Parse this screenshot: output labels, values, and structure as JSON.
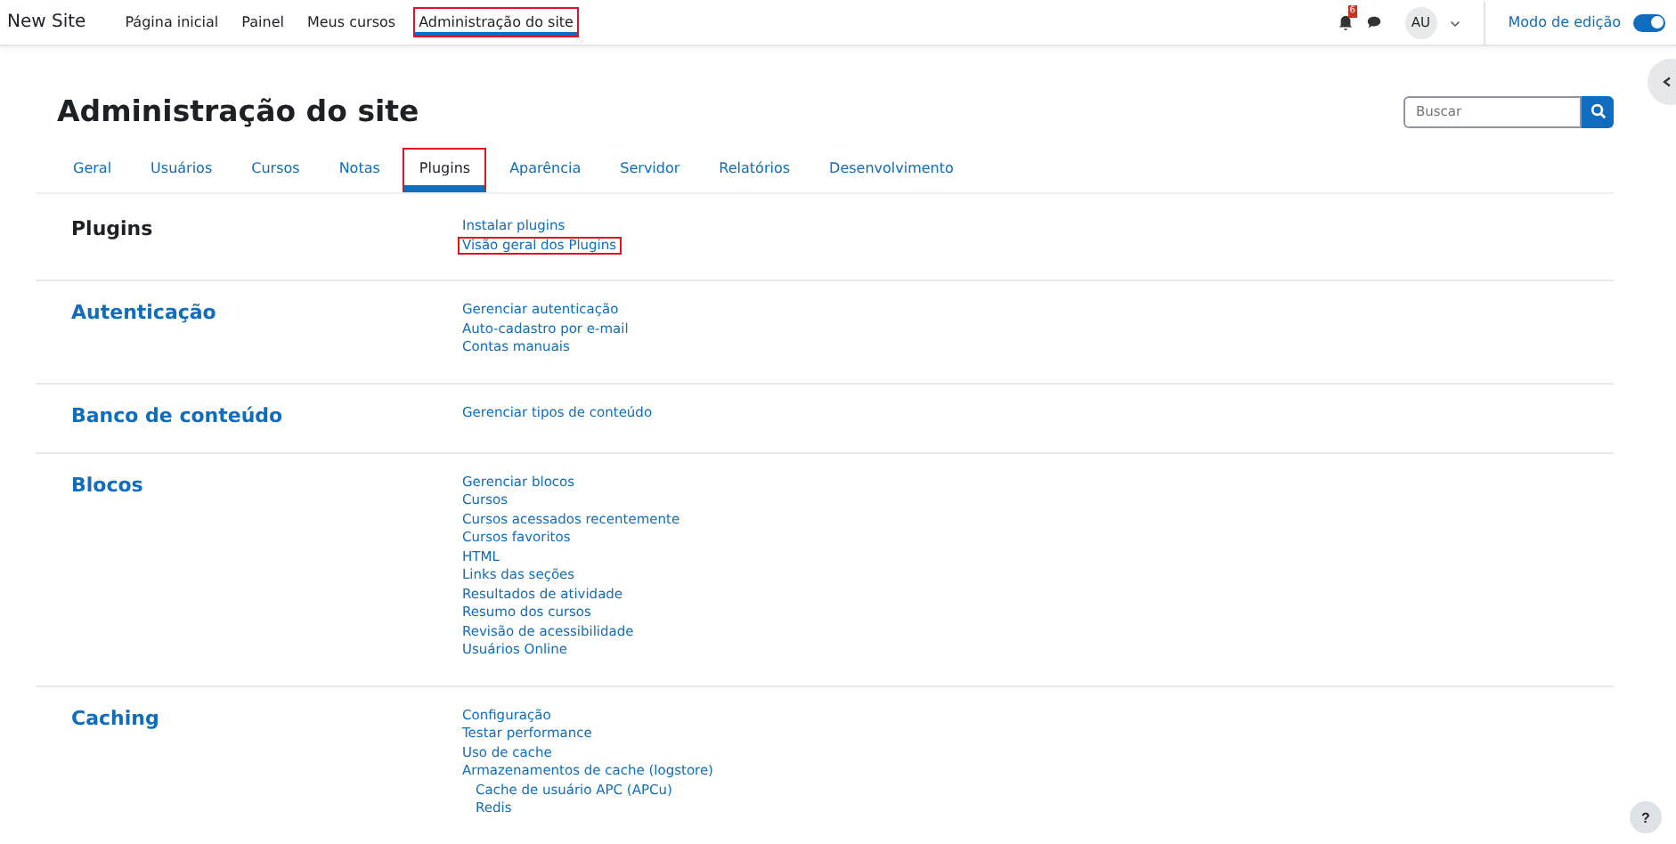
{
  "navbar": {
    "brand": "New Site",
    "items": [
      {
        "label": "Página inicial",
        "selected": false,
        "highlighted": false
      },
      {
        "label": "Painel",
        "selected": false,
        "highlighted": false
      },
      {
        "label": "Meus cursos",
        "selected": false,
        "highlighted": false
      },
      {
        "label": "Administração do site",
        "selected": true,
        "highlighted": true
      }
    ],
    "notification_count": "6",
    "avatar": "AU",
    "edit_mode": {
      "label": "Modo de edição",
      "on": true
    }
  },
  "page_title": "Administração do site",
  "search": {
    "placeholder": "Buscar"
  },
  "tabs": [
    {
      "label": "Geral",
      "selected": false,
      "highlighted": false
    },
    {
      "label": "Usuários",
      "selected": false,
      "highlighted": false
    },
    {
      "label": "Cursos",
      "selected": false,
      "highlighted": false
    },
    {
      "label": "Notas",
      "selected": false,
      "highlighted": false
    },
    {
      "label": "Plugins",
      "selected": true,
      "highlighted": true
    },
    {
      "label": "Aparência",
      "selected": false,
      "highlighted": false
    },
    {
      "label": "Servidor",
      "selected": false,
      "highlighted": false
    },
    {
      "label": "Relatórios",
      "selected": false,
      "highlighted": false
    },
    {
      "label": "Desenvolvimento",
      "selected": false,
      "highlighted": false
    }
  ],
  "sections": [
    {
      "title": "Plugins",
      "is_link": false,
      "links": [
        {
          "label": "Instalar plugins",
          "highlighted": false
        },
        {
          "label": "Visão geral dos Plugins",
          "highlighted": true
        }
      ]
    },
    {
      "title": "Autenticação",
      "is_link": true,
      "links": [
        {
          "label": "Gerenciar autenticação",
          "highlighted": false
        },
        {
          "label": "Auto-cadastro por e-mail",
          "highlighted": false
        },
        {
          "label": "Contas manuais",
          "highlighted": false
        }
      ]
    },
    {
      "title": "Banco de conteúdo",
      "is_link": true,
      "links": [
        {
          "label": "Gerenciar tipos de conteúdo",
          "highlighted": false
        }
      ]
    },
    {
      "title": "Blocos",
      "is_link": true,
      "links": [
        {
          "label": "Gerenciar blocos",
          "highlighted": false
        },
        {
          "label": "Cursos",
          "highlighted": false
        },
        {
          "label": "Cursos acessados recentemente",
          "highlighted": false
        },
        {
          "label": "Cursos favoritos",
          "highlighted": false
        },
        {
          "label": "HTML",
          "highlighted": false
        },
        {
          "label": "Links das seções",
          "highlighted": false
        },
        {
          "label": "Resultados de atividade",
          "highlighted": false
        },
        {
          "label": "Resumo dos cursos",
          "highlighted": false
        },
        {
          "label": "Revisão de acessibilidade",
          "highlighted": false
        },
        {
          "label": "Usuários Online",
          "highlighted": false
        }
      ]
    },
    {
      "title": "Caching",
      "is_link": true,
      "links": [
        {
          "label": "Configuração",
          "highlighted": false
        },
        {
          "label": "Testar performance",
          "highlighted": false
        },
        {
          "label": "Uso de cache",
          "highlighted": false
        },
        {
          "label": "Armazenamentos de cache (logstore)",
          "highlighted": false,
          "children": [
            {
              "label": "Cache de usuário APC (APCu)",
              "highlighted": false
            },
            {
              "label": "Redis",
              "highlighted": false
            }
          ]
        }
      ]
    }
  ],
  "help_button": "?"
}
